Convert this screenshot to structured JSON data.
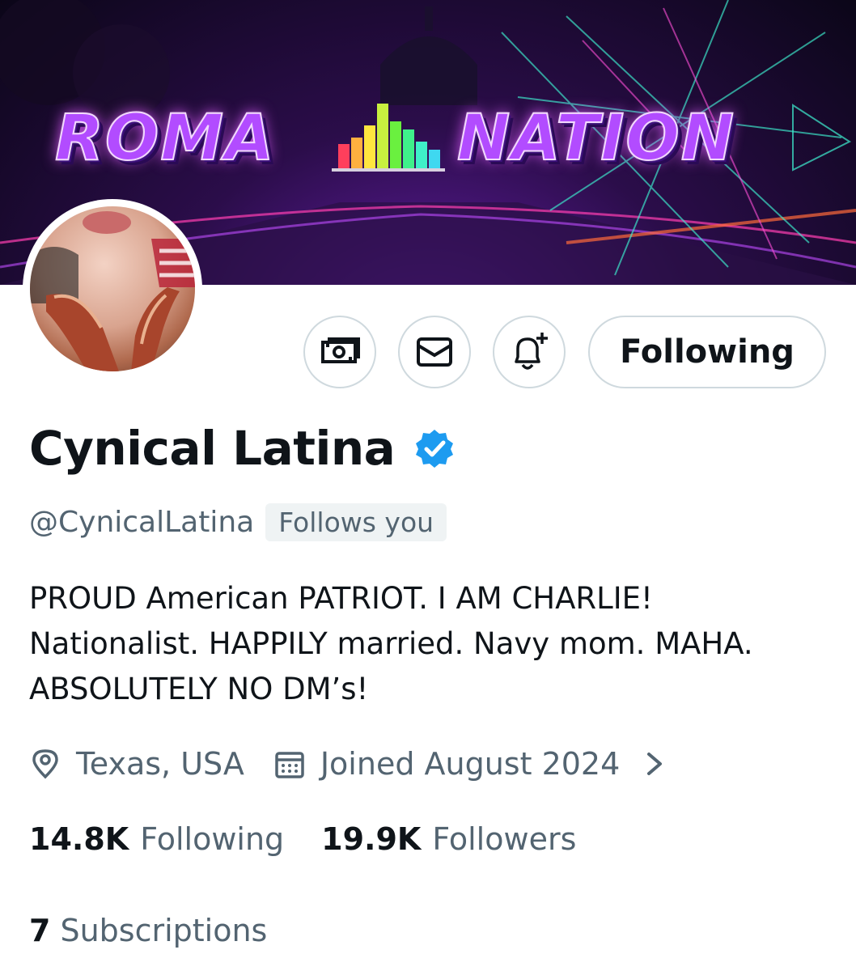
{
  "banner": {
    "title_left": "ROMA",
    "title_right": "NATION"
  },
  "actions": {
    "subscribe_icon": "money-icon",
    "message_icon": "envelope-icon",
    "notify_icon": "bell-plus-icon",
    "following_label": "Following"
  },
  "profile": {
    "display_name": "Cynical Latina",
    "verified": true,
    "handle": "@CynicalLatina",
    "follows_you": "Follows you",
    "bio_lines": [
      "PROUD American PATRIOT. I AM CHARLIE!",
      "Nationalist. HAPPILY married. Navy mom. MAHA.",
      "ABSOLUTELY NO DM’s!"
    ],
    "location": "Texas, USA",
    "joined": "Joined August 2024"
  },
  "stats": {
    "following_count": "14.8K",
    "following_label": "Following",
    "followers_count": "19.9K",
    "followers_label": "Followers",
    "subscriptions_count": "7",
    "subscriptions_label": "Subscriptions"
  },
  "colors": {
    "verified_blue": "#1d9bf0",
    "secondary_text": "#536471",
    "border": "#cfd9de"
  }
}
